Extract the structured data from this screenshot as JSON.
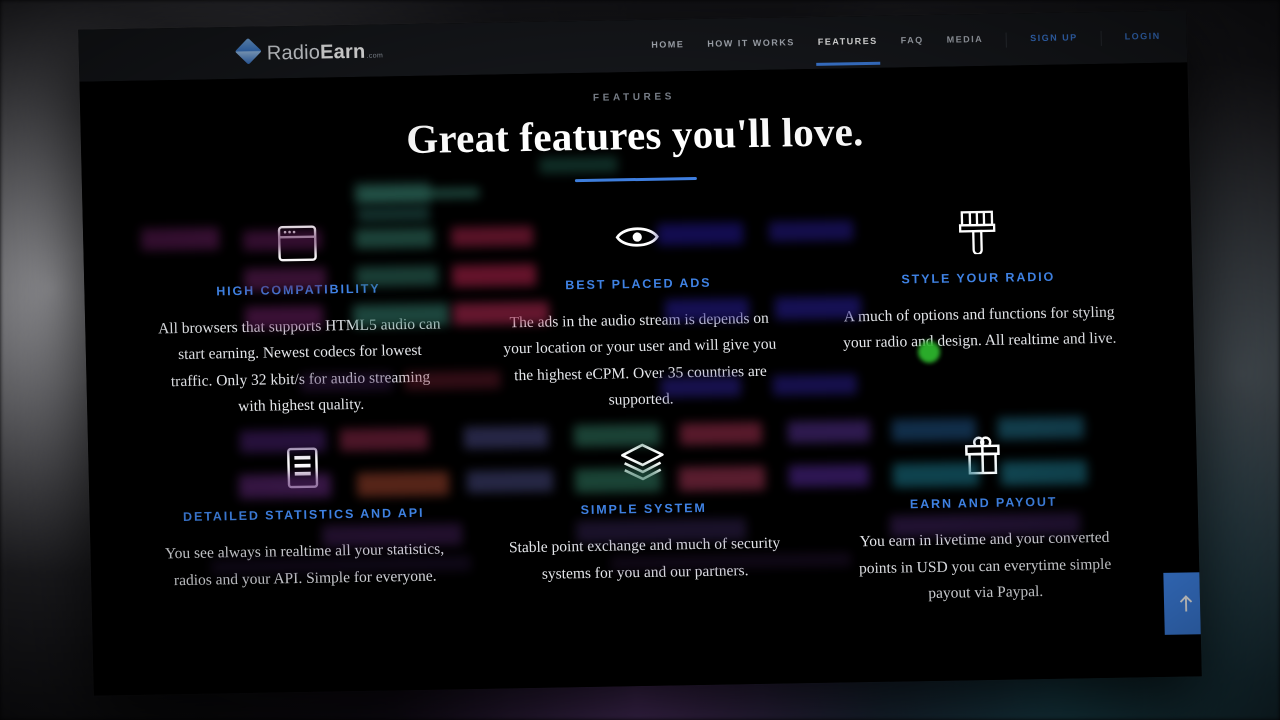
{
  "header": {
    "brand": {
      "prefix": "Radio",
      "strong": "Earn",
      "suffix": ".com"
    },
    "nav": [
      {
        "label": "HOME",
        "state": "normal"
      },
      {
        "label": "HOW IT WORKS",
        "state": "normal"
      },
      {
        "label": "FEATURES",
        "state": "active"
      },
      {
        "label": "FAQ",
        "state": "normal"
      },
      {
        "label": "MEDIA",
        "state": "normal"
      },
      {
        "label": "SIGN UP",
        "state": "accent"
      },
      {
        "label": "LOGIN",
        "state": "accent"
      }
    ]
  },
  "hero": {
    "eyebrow": "FEATURES",
    "headline": "Great features you'll love."
  },
  "features": [
    {
      "icon": "browser-window-icon",
      "title": "HIGH COMPATIBILITY",
      "text": "All browsers that supports HTML5 audio can start earning. Newest codecs for lowest traffic. Only 32 kbit/s for audio streaming with highest quality."
    },
    {
      "icon": "eye-icon",
      "title": "BEST PLACED ADS",
      "text": "The ads in the audio stream is depends on your location or your user and will give you the highest eCPM. Over 35 countries are supported."
    },
    {
      "icon": "paintbrush-icon",
      "title": "STYLE YOUR RADIO",
      "text": "A much of options and functions for styling your radio and design. All realtime and live."
    },
    {
      "icon": "document-list-icon",
      "title": "DETAILED STATISTICS AND API",
      "text": "You see always in realtime all your statistics, radios and your API. Simple for everyone."
    },
    {
      "icon": "layers-icon",
      "title": "SIMPLE SYSTEM",
      "text": "Stable point exchange and much of security systems for you and our partners."
    },
    {
      "icon": "gift-box-icon",
      "title": "EARN AND PAYOUT",
      "text": "You earn in livetime and your converted points in USD you can everytime simple payout via Paypal."
    }
  ],
  "scroll_top": {
    "icon": "arrow-up-icon",
    "label": ""
  },
  "colors": {
    "accent_blue": "#3f82e4",
    "header_bg": "#16181c",
    "page_bg": "#000000",
    "body_text": "#e4e6ea",
    "eyebrow_text": "#7e858f",
    "scroll_top_bg": "#3f86ec"
  }
}
